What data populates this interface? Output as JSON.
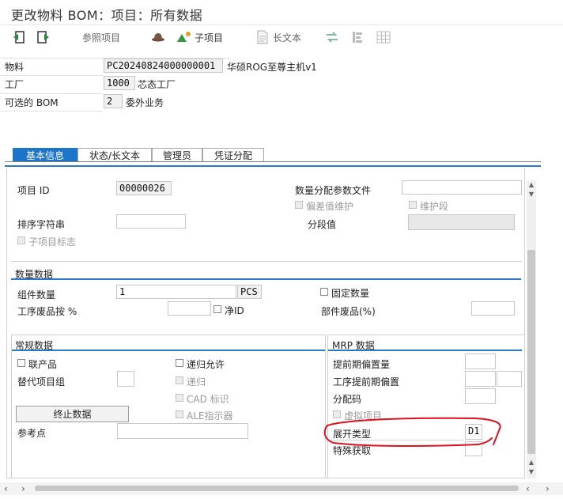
{
  "window": {
    "title": "更改物料 BOM：项目：所有数据"
  },
  "toolbar": {
    "ref_item": "参照项目",
    "sub_item": "子项目",
    "long_text": "长文本"
  },
  "header": {
    "material_label": "物料",
    "material_value": "PC20240824000000001",
    "material_desc": "华硕ROG至尊主机v1",
    "plant_label": "工厂",
    "plant_value": "1000",
    "plant_desc": "芯态工厂",
    "alt_bom_label": "可选的 BOM",
    "alt_bom_value": "2",
    "alt_bom_desc": "委外业务"
  },
  "tabs": [
    {
      "label": "基本信息",
      "active": true
    },
    {
      "label": "状态/长文本",
      "active": false
    },
    {
      "label": "管理员",
      "active": false
    },
    {
      "label": "凭证分配",
      "active": false
    }
  ],
  "item": {
    "item_id_label": "项目 ID",
    "item_id_value": "00000026",
    "qty_dist_label": "数量分配参数文件",
    "qty_dist_value": "",
    "deviation_label": "偏差值维护",
    "maint_seg_label": "维护段",
    "sort_string_label": "排序字符串",
    "sort_string_value": "",
    "segment_value_label": "分段值",
    "segment_value_value": "",
    "sub_item_flag_label": "子项目标志"
  },
  "quantity": {
    "section_title": "数量数据",
    "component_qty_label": "组件数量",
    "component_qty_value": "1",
    "unit_value": "PCS",
    "fixed_qty_label": "固定数量",
    "op_scrap_label": "工序废品按 %",
    "op_scrap_value": "",
    "net_id_label": "净ID",
    "comp_scrap_label": "部件废品(%)",
    "comp_scrap_value": ""
  },
  "general": {
    "section_title": "常规数据",
    "co_product_label": "联产品",
    "recursive_allowed_label": "递归允许",
    "alt_item_group_label": "替代项目组",
    "alt_item_group_value": "",
    "recursive_label": "递归",
    "cad_label": "CAD 标识",
    "ale_label": "ALE指示器",
    "discontinue_button": "终止数据",
    "ref_point_label": "参考点",
    "ref_point_value": ""
  },
  "mrp": {
    "section_title": "MRP 数据",
    "lead_offset_label": "提前期偏置量",
    "lead_offset_value": "",
    "op_lead_offset_label": "工序提前期偏置",
    "op_lead_offset_value": "",
    "dist_key_label": "分配码",
    "dist_key_value": "",
    "phantom_label": "虚拟项目",
    "explosion_type_label": "展开类型",
    "explosion_type_value": "D1",
    "special_proc_label": "特殊获取",
    "special_proc_value": ""
  },
  "annotation": {
    "color": "#e0101f"
  }
}
